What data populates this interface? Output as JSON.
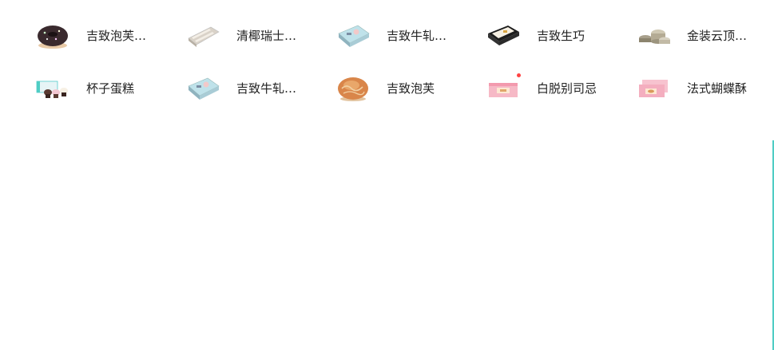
{
  "products": [
    {
      "label": "吉致泡芙…",
      "icon": "donut-icon",
      "badge": false
    },
    {
      "label": "清椰瑞士…",
      "icon": "swiss-roll-box-icon",
      "badge": false
    },
    {
      "label": "吉致牛轧…",
      "icon": "nougat-box-icon",
      "badge": false
    },
    {
      "label": "吉致生巧",
      "icon": "chocolate-box-icon",
      "badge": false
    },
    {
      "label": "金装云顶…",
      "icon": "tins-icon",
      "badge": false
    },
    {
      "label": "杯子蛋糕",
      "icon": "cupcakes-icon",
      "badge": false
    },
    {
      "label": "吉致牛轧…",
      "icon": "nougat-box-icon",
      "badge": false
    },
    {
      "label": "吉致泡芙",
      "icon": "puff-pastry-icon",
      "badge": false
    },
    {
      "label": "白脱别司忌",
      "icon": "pink-box-icon",
      "badge": true
    },
    {
      "label": "法式蝴蝶酥",
      "icon": "pink-boxes-icon",
      "badge": false
    }
  ],
  "colors": {
    "accent": "#4ecdc4",
    "badge": "#ff4444"
  }
}
